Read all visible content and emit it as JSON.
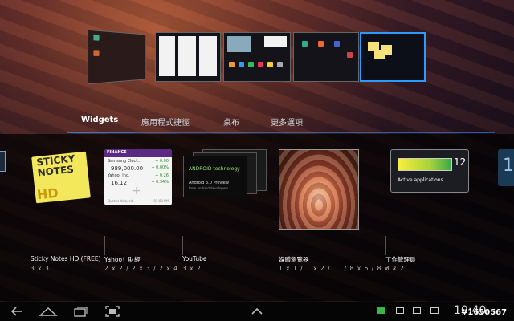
{
  "tabs": [
    {
      "label": "Widgets",
      "active": true
    },
    {
      "label": "應用程式捷徑",
      "active": false
    },
    {
      "label": "桌布",
      "active": false
    },
    {
      "label": "更多選項",
      "active": false
    }
  ],
  "widgets": [
    {
      "name": "Sticky Notes HD (FREE)",
      "size": "3 x 3"
    },
    {
      "name": "Yahoo！財經",
      "size": "2 x 2 / 2 x 3 / 2 x 4"
    },
    {
      "name": "YouTube",
      "size": "3 x 2"
    },
    {
      "name": "媒體瀏覽器",
      "size": "1 x 1 / 1 x 2 / ... / 8 x 6 / 8 x 7"
    },
    {
      "name": "工作管理員",
      "size": "3 x 2"
    }
  ],
  "sticky": {
    "line1": "STICKY",
    "line2": "NOTES",
    "hd": "HD"
  },
  "finance": {
    "header": "FINANCE",
    "row1_name": "Samsung Elect...",
    "row1_change": "+ 0.00",
    "row1_value": "989,000.00",
    "row1_pct": "+ 0.00%",
    "row2_name": "Yahoo! Inc.",
    "row2_change": "+ 0.26",
    "row2_value": "16.12",
    "row2_pct": "+ 0.34%",
    "footer": "Quotes delayed",
    "time": "03:00 PM"
  },
  "youtube": {
    "brand": "ANDROID technology",
    "title": "Android 3.0 Preview",
    "sub": "from android developers"
  },
  "taskmgr": {
    "count": "12",
    "label": "Active applications"
  },
  "right_page": "1",
  "clock": "10:40",
  "watermark": "#1650567"
}
